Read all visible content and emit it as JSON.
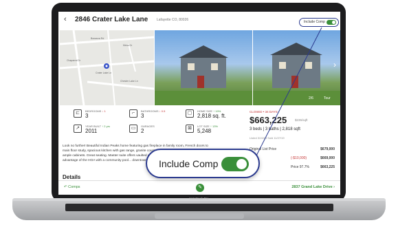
{
  "header": {
    "back_icon": "chevron-left-icon",
    "address": "2846 Crater Lake Lane",
    "location": "Lafayette CO, 80026",
    "include_comp_label": "Include Comp",
    "include_comp_on": true
  },
  "gallery": {
    "photo_count": "2/6",
    "tour_label": "Tour"
  },
  "map": {
    "streets": [
      "Bonanza Rd",
      "Mesa Dr",
      "Crater Lake Ln",
      "Chaparral Dr",
      "Chester Lake Ln"
    ]
  },
  "stats": [
    {
      "icon": "bed-icon",
      "label": "BEDROOMS",
      "change": "1",
      "change_dir": "down",
      "value": "3"
    },
    {
      "icon": "bath-icon",
      "label": "BATHROOMS",
      "change": "0.5",
      "change_dir": "down",
      "value": "3"
    },
    {
      "icon": "home-size-icon",
      "label": "HOME SIZE",
      "change": "19%",
      "change_dir": "up",
      "value": "2,818 sq. ft."
    },
    {
      "icon": "year-built-icon",
      "label": "YEAR BUILT",
      "change": "2 yrs",
      "change_dir": "up",
      "value": "2011"
    },
    {
      "icon": "garage-icon",
      "label": "GARAGES",
      "change": "",
      "change_dir": "",
      "value": "2"
    },
    {
      "icon": "lot-size-icon",
      "label": "LOT SIZE",
      "change": "13%",
      "change_dir": "up",
      "value": "5,248"
    }
  ],
  "panel": {
    "status": "CLOSED • 34 DAYS",
    "price": "$663,225",
    "price_per_sqft": "$235/sqft",
    "beds": "3 beds",
    "baths": "3 baths",
    "sqft": "2,818 sqft",
    "dates": "Listed 3/19/19   Sold 11/27/19",
    "rows": [
      {
        "label": "Original List Price",
        "value": "$679,000"
      },
      {
        "label": "(-$10,000)",
        "value": "$669,000"
      },
      {
        "label": "Price 97.7%",
        "value": "$663,225"
      }
    ]
  },
  "description": "Look no further! Beautiful Indian Peaks home featuring gas fireplace in family room, French doors to main floor study, spacious kitchen with gas range, granite countertops, stainless steel appliances and ample cabinets. Great seating. Master suite offers vaulted ceilings, walk-in closet, double sinks... advantage of the HOA with a community pool... downtown Louisville and Lafayette! Welcome...",
  "details_heading": "Details",
  "footer": {
    "back_label": "Comps",
    "edit_icon": "pencil-icon",
    "next_label": "2837 Grand Lake Drive"
  },
  "callout": {
    "label": "Include Comp",
    "on": true
  },
  "device": {
    "brand_label": "NoteBook Pro"
  },
  "colors": {
    "accent_green": "#3a8f3a",
    "accent_blue": "#2b3a8f",
    "negative_red": "#c53434"
  }
}
